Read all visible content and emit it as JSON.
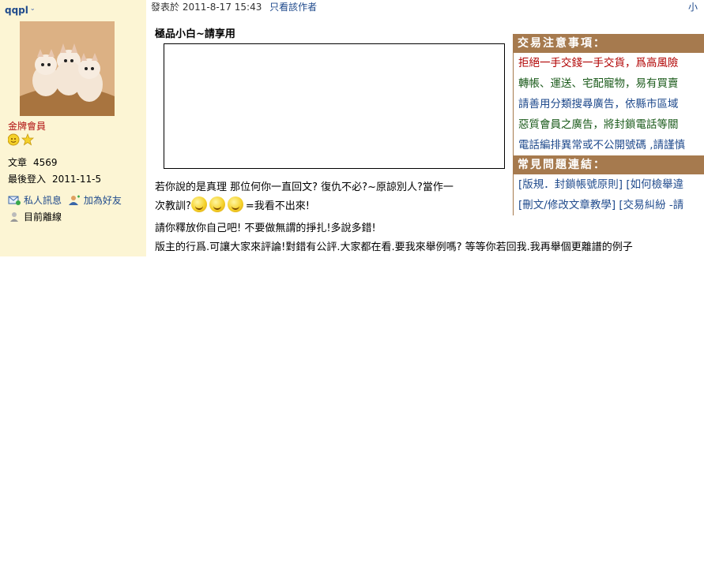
{
  "user": {
    "name": "qqpl",
    "rank": "金牌會員",
    "posts_label": "文章",
    "posts_value": "4569",
    "lastlogin_label": "最後登入",
    "lastlogin_value": "2011-11-5",
    "pm_label": "私人訊息",
    "addfriend_label": "加為好友",
    "status_label": "目前離線"
  },
  "post": {
    "posted_label": "發表於",
    "posted_time": "2011-8-17 15:43",
    "only_author": "只看該作者",
    "size_link": "小",
    "title": "極品小白~請享用",
    "line1": "若你說的是真理 那位何你一直回文?  復仇不必?~原諒別人?當作一",
    "line2a": "次教訓?",
    "line2b": "=我看不出來!",
    "line3": "請你釋放你自己吧!  不要做無謂的掙扎!多說多錯!",
    "line4": "版主的行爲.可讓大家來評論!對錯有公評.大家都在看.要我來舉例嗎?  等等你若回我.我再舉個更離譜的例子"
  },
  "notice": {
    "header1": "交易注意事項：",
    "items": [
      "拒絕一手交錢一手交貨，爲高風險",
      "轉帳、運送、宅配寵物，易有買賣",
      "請善用分類搜尋廣告，依縣市區域",
      "惡質會員之廣告，將封鎖電話等關",
      "電話編排異常或不公開號碼 ,請謹慎"
    ],
    "header2": "常見問題連結：",
    "faq": [
      "[版規．封鎖帳號原則] [如何檢舉違",
      "[刪文/修改文章教學] [交易糾紛 -請"
    ]
  }
}
